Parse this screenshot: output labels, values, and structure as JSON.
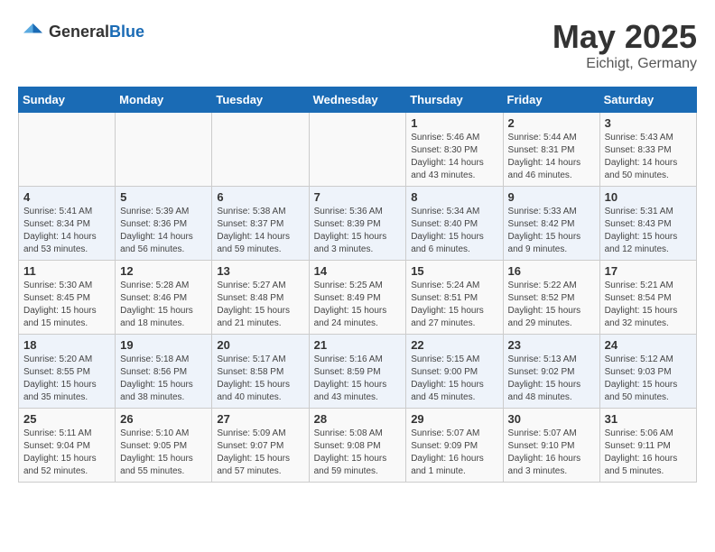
{
  "header": {
    "logo_general": "General",
    "logo_blue": "Blue",
    "month": "May 2025",
    "location": "Eichigt, Germany"
  },
  "weekdays": [
    "Sunday",
    "Monday",
    "Tuesday",
    "Wednesday",
    "Thursday",
    "Friday",
    "Saturday"
  ],
  "weeks": [
    [
      {
        "day": "",
        "info": ""
      },
      {
        "day": "",
        "info": ""
      },
      {
        "day": "",
        "info": ""
      },
      {
        "day": "",
        "info": ""
      },
      {
        "day": "1",
        "info": "Sunrise: 5:46 AM\nSunset: 8:30 PM\nDaylight: 14 hours\nand 43 minutes."
      },
      {
        "day": "2",
        "info": "Sunrise: 5:44 AM\nSunset: 8:31 PM\nDaylight: 14 hours\nand 46 minutes."
      },
      {
        "day": "3",
        "info": "Sunrise: 5:43 AM\nSunset: 8:33 PM\nDaylight: 14 hours\nand 50 minutes."
      }
    ],
    [
      {
        "day": "4",
        "info": "Sunrise: 5:41 AM\nSunset: 8:34 PM\nDaylight: 14 hours\nand 53 minutes."
      },
      {
        "day": "5",
        "info": "Sunrise: 5:39 AM\nSunset: 8:36 PM\nDaylight: 14 hours\nand 56 minutes."
      },
      {
        "day": "6",
        "info": "Sunrise: 5:38 AM\nSunset: 8:37 PM\nDaylight: 14 hours\nand 59 minutes."
      },
      {
        "day": "7",
        "info": "Sunrise: 5:36 AM\nSunset: 8:39 PM\nDaylight: 15 hours\nand 3 minutes."
      },
      {
        "day": "8",
        "info": "Sunrise: 5:34 AM\nSunset: 8:40 PM\nDaylight: 15 hours\nand 6 minutes."
      },
      {
        "day": "9",
        "info": "Sunrise: 5:33 AM\nSunset: 8:42 PM\nDaylight: 15 hours\nand 9 minutes."
      },
      {
        "day": "10",
        "info": "Sunrise: 5:31 AM\nSunset: 8:43 PM\nDaylight: 15 hours\nand 12 minutes."
      }
    ],
    [
      {
        "day": "11",
        "info": "Sunrise: 5:30 AM\nSunset: 8:45 PM\nDaylight: 15 hours\nand 15 minutes."
      },
      {
        "day": "12",
        "info": "Sunrise: 5:28 AM\nSunset: 8:46 PM\nDaylight: 15 hours\nand 18 minutes."
      },
      {
        "day": "13",
        "info": "Sunrise: 5:27 AM\nSunset: 8:48 PM\nDaylight: 15 hours\nand 21 minutes."
      },
      {
        "day": "14",
        "info": "Sunrise: 5:25 AM\nSunset: 8:49 PM\nDaylight: 15 hours\nand 24 minutes."
      },
      {
        "day": "15",
        "info": "Sunrise: 5:24 AM\nSunset: 8:51 PM\nDaylight: 15 hours\nand 27 minutes."
      },
      {
        "day": "16",
        "info": "Sunrise: 5:22 AM\nSunset: 8:52 PM\nDaylight: 15 hours\nand 29 minutes."
      },
      {
        "day": "17",
        "info": "Sunrise: 5:21 AM\nSunset: 8:54 PM\nDaylight: 15 hours\nand 32 minutes."
      }
    ],
    [
      {
        "day": "18",
        "info": "Sunrise: 5:20 AM\nSunset: 8:55 PM\nDaylight: 15 hours\nand 35 minutes."
      },
      {
        "day": "19",
        "info": "Sunrise: 5:18 AM\nSunset: 8:56 PM\nDaylight: 15 hours\nand 38 minutes."
      },
      {
        "day": "20",
        "info": "Sunrise: 5:17 AM\nSunset: 8:58 PM\nDaylight: 15 hours\nand 40 minutes."
      },
      {
        "day": "21",
        "info": "Sunrise: 5:16 AM\nSunset: 8:59 PM\nDaylight: 15 hours\nand 43 minutes."
      },
      {
        "day": "22",
        "info": "Sunrise: 5:15 AM\nSunset: 9:00 PM\nDaylight: 15 hours\nand 45 minutes."
      },
      {
        "day": "23",
        "info": "Sunrise: 5:13 AM\nSunset: 9:02 PM\nDaylight: 15 hours\nand 48 minutes."
      },
      {
        "day": "24",
        "info": "Sunrise: 5:12 AM\nSunset: 9:03 PM\nDaylight: 15 hours\nand 50 minutes."
      }
    ],
    [
      {
        "day": "25",
        "info": "Sunrise: 5:11 AM\nSunset: 9:04 PM\nDaylight: 15 hours\nand 52 minutes."
      },
      {
        "day": "26",
        "info": "Sunrise: 5:10 AM\nSunset: 9:05 PM\nDaylight: 15 hours\nand 55 minutes."
      },
      {
        "day": "27",
        "info": "Sunrise: 5:09 AM\nSunset: 9:07 PM\nDaylight: 15 hours\nand 57 minutes."
      },
      {
        "day": "28",
        "info": "Sunrise: 5:08 AM\nSunset: 9:08 PM\nDaylight: 15 hours\nand 59 minutes."
      },
      {
        "day": "29",
        "info": "Sunrise: 5:07 AM\nSunset: 9:09 PM\nDaylight: 16 hours\nand 1 minute."
      },
      {
        "day": "30",
        "info": "Sunrise: 5:07 AM\nSunset: 9:10 PM\nDaylight: 16 hours\nand 3 minutes."
      },
      {
        "day": "31",
        "info": "Sunrise: 5:06 AM\nSunset: 9:11 PM\nDaylight: 16 hours\nand 5 minutes."
      }
    ]
  ]
}
